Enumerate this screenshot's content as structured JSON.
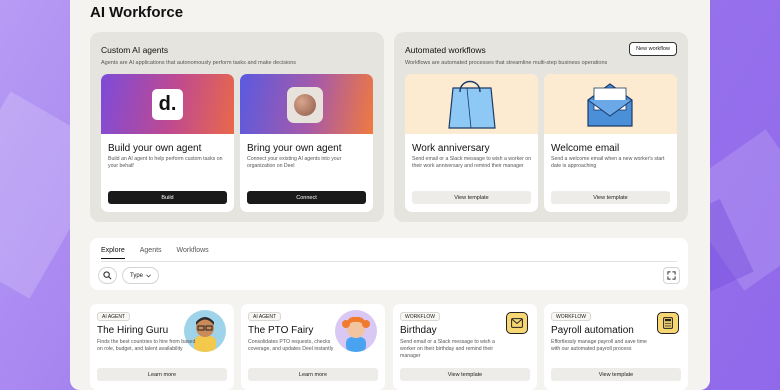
{
  "app": {
    "title": "AI Workforce"
  },
  "custom_agents": {
    "title": "Custom AI agents",
    "subtitle": "Agents are AI applications that autonomously perform tasks and make decisions",
    "cards": [
      {
        "name": "Build your own agent",
        "desc": "Build an AI agent to help perform custom tasks on your behalf",
        "button": "Build",
        "logo_text": "d."
      },
      {
        "name": "Bring your own agent",
        "desc": "Connect your existing AI agents into your organization on Deel",
        "button": "Connect"
      }
    ]
  },
  "automated_workflows": {
    "title": "Automated workflows",
    "subtitle": "Workflows are automated processes that streamline multi-step business operations",
    "new_button": "New workflow",
    "cards": [
      {
        "name": "Work anniversary",
        "desc": "Send email or a Slack message to wish a worker on their work anniversary and remind their manager",
        "button": "View template"
      },
      {
        "name": "Welcome email",
        "desc": "Send a welcome email when a new worker's start date is approaching",
        "button": "View template"
      }
    ]
  },
  "explore": {
    "tabs": [
      "Explore",
      "Agents",
      "Workflows"
    ],
    "active_tab": "Explore",
    "type_filter": "Type"
  },
  "templates": [
    {
      "badge": "AI AGENT",
      "name": "The Hiring Guru",
      "desc": "Finds the best countries to hire from based on role, budget, and talent availability",
      "button": "Learn more"
    },
    {
      "badge": "AI AGENT",
      "name": "The PTO Fairy",
      "desc": "Consolidates PTO requests, checks coverage, and updates Deel instantly",
      "button": "Learn more"
    },
    {
      "badge": "WORKFLOW",
      "name": "Birthday",
      "desc": "Send email or a Slack message to wish a worker on their birthday and remind their manager",
      "button": "View template"
    },
    {
      "badge": "WORKFLOW",
      "name": "Payroll automation",
      "desc": "Effortlessly manage payroll and save time with our automated payroll process",
      "button": "View template"
    }
  ],
  "colors": {
    "accent_purple": "#9d78ee",
    "dark_button": "#1a1a1a",
    "cream": "#fcebd1",
    "icon_yellow": "#f7d774"
  },
  "icons": [
    "deel-logo",
    "sphere-image",
    "shopping-bag-illustration",
    "envelope-illustration",
    "search-icon",
    "chevron-down-icon",
    "expand-icon",
    "hiring-guru-avatar",
    "pto-fairy-avatar",
    "mail-icon",
    "calculator-icon"
  ]
}
